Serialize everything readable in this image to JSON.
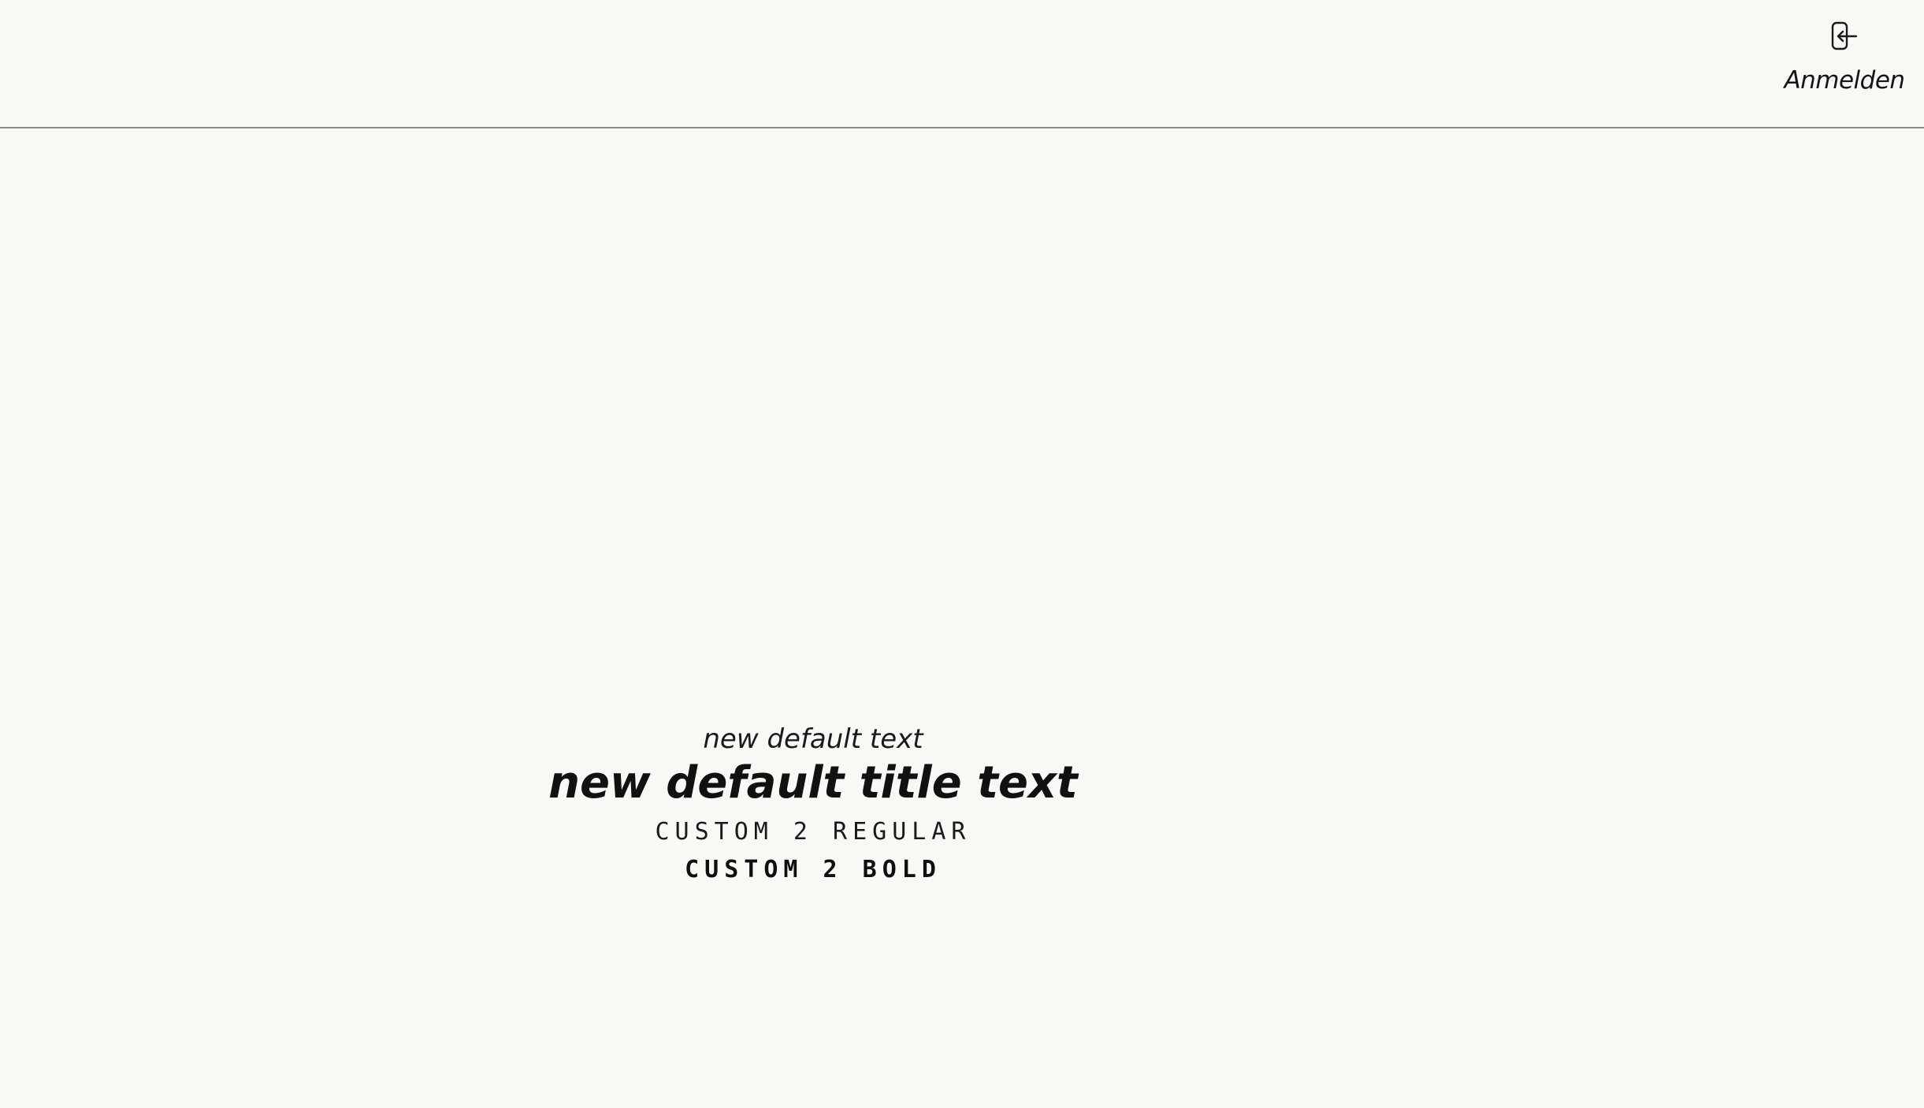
{
  "header": {
    "login": {
      "icon": "login-icon",
      "label": "Anmelden"
    }
  },
  "main": {
    "samples": {
      "default_text": "new default text",
      "default_title": "new default title text",
      "custom_regular": "CUSTOM 2 REGULAR",
      "custom_bold": "CUSTOM 2 BOLD"
    }
  }
}
